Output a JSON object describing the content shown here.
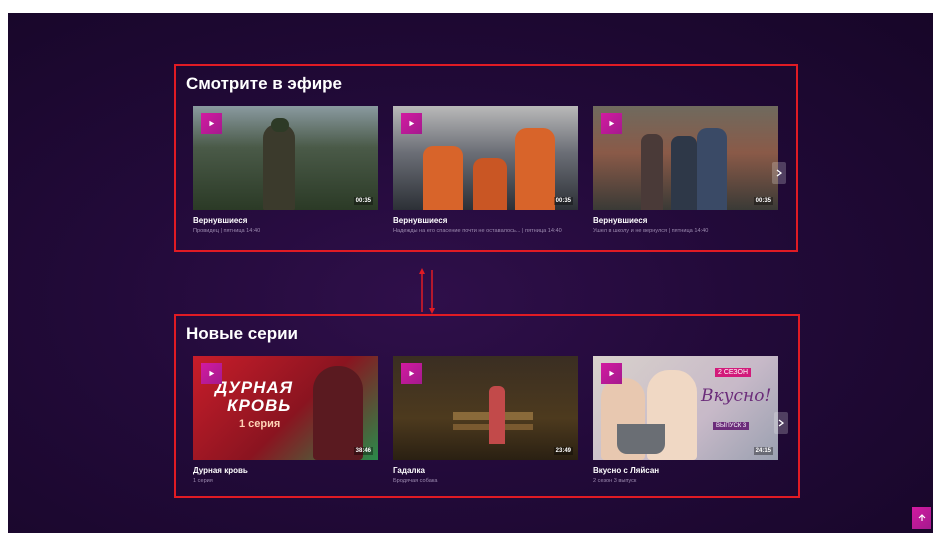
{
  "sections": [
    {
      "title": "Смотрите в эфире",
      "cards": [
        {
          "title": "Вернувшиеся",
          "subtitle": "Провидец | пятница 14:40",
          "duration": "00:35"
        },
        {
          "title": "Вернувшиеся",
          "subtitle": "Надежды на его спасение почти не оставалось... | пятница 14:40",
          "duration": "00:35"
        },
        {
          "title": "Вернувшиеся",
          "subtitle": "Ушел в школу и не вернулся | пятница 14:40",
          "duration": "00:35"
        }
      ]
    },
    {
      "title": "Новые серии",
      "cards": [
        {
          "title": "Дурная кровь",
          "subtitle": "1 серия",
          "duration": "38:46",
          "art": {
            "word1": "ДУРНАЯ",
            "word2": "КРОВЬ",
            "episode": "1 серия"
          }
        },
        {
          "title": "Гадалка",
          "subtitle": "Бродячая собака",
          "duration": "23:49"
        },
        {
          "title": "Вкусно с Ляйсан",
          "subtitle": "2 сезон 3 выпуск",
          "duration": "24:15",
          "art": {
            "badge": "2 СЕЗОН",
            "brand": "Вкусно!",
            "issue": "ВЫПУСК 3"
          }
        }
      ]
    }
  ],
  "icons": {
    "play": "play-icon",
    "next": "chevron-right-icon",
    "scroll_top": "arrow-up-icon",
    "annotation": "swap-arrows-icon"
  },
  "colors": {
    "accent": "#d21aa0",
    "highlight_box": "#e01b24",
    "background": "#220a39"
  }
}
